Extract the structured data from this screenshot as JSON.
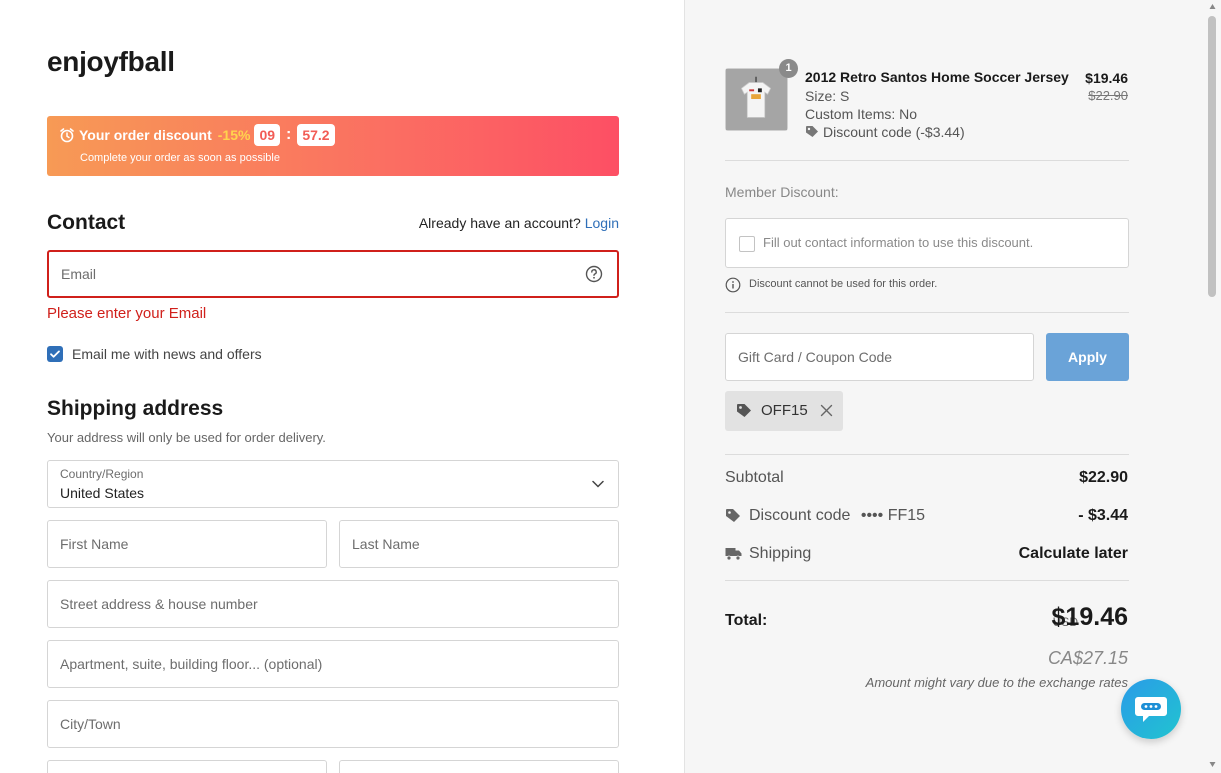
{
  "brand": "enjoyfball",
  "banner": {
    "title": "Your order discount",
    "percent": "-15%",
    "minutes": "09",
    "seconds": "57.2",
    "subtitle": "Complete your order as soon as possible"
  },
  "contact": {
    "heading": "Contact",
    "have_account": "Already have an account?",
    "login_label": "Login",
    "email_placeholder": "Email",
    "email_error": "Please enter your Email",
    "newsletter_label": "Email me with news and offers",
    "newsletter_checked": true
  },
  "shipping": {
    "heading": "Shipping address",
    "subtitle": "Your address will only be used for order delivery.",
    "country_label": "Country/Region",
    "country_value": "United States",
    "first_name_placeholder": "First Name",
    "last_name_placeholder": "Last Name",
    "street_placeholder": "Street address & house number",
    "apartment_placeholder": "Apartment, suite, building floor... (optional)",
    "city_placeholder": "City/Town"
  },
  "cart": {
    "item": {
      "quantity": "1",
      "name": "2012 Retro Santos Home Soccer Jersey",
      "size": "Size: S",
      "custom_items": "Custom Items: No",
      "discount": "Discount code (-$3.44)",
      "price": "$19.46",
      "original_price": "$22.90"
    },
    "member_discount_label": "Member Discount:",
    "member_discount_text": "Fill out contact information to use this discount.",
    "member_discount_note": "Discount cannot be used for this order.",
    "coupon_placeholder": "Gift Card / Coupon Code",
    "apply_label": "Apply",
    "applied_code": "OFF15",
    "summary": {
      "subtotal_label": "Subtotal",
      "subtotal_value": "$22.90",
      "discount_label": "Discount code",
      "discount_code_masked": "•••• FF15",
      "discount_value": "- $3.44",
      "shipping_label": "Shipping",
      "shipping_value": "Calculate later"
    },
    "total": {
      "label": "Total:",
      "currency": "USD",
      "value": "$19.46",
      "converted": "CA$27.15",
      "note": "Amount might vary due to the exchange rates"
    }
  },
  "colors": {
    "accent": "#2f6fb8",
    "error": "#d0201b",
    "apply_button": "#6aa3d8",
    "banner_start": "#f79a55",
    "banner_end": "#fd4f64"
  }
}
